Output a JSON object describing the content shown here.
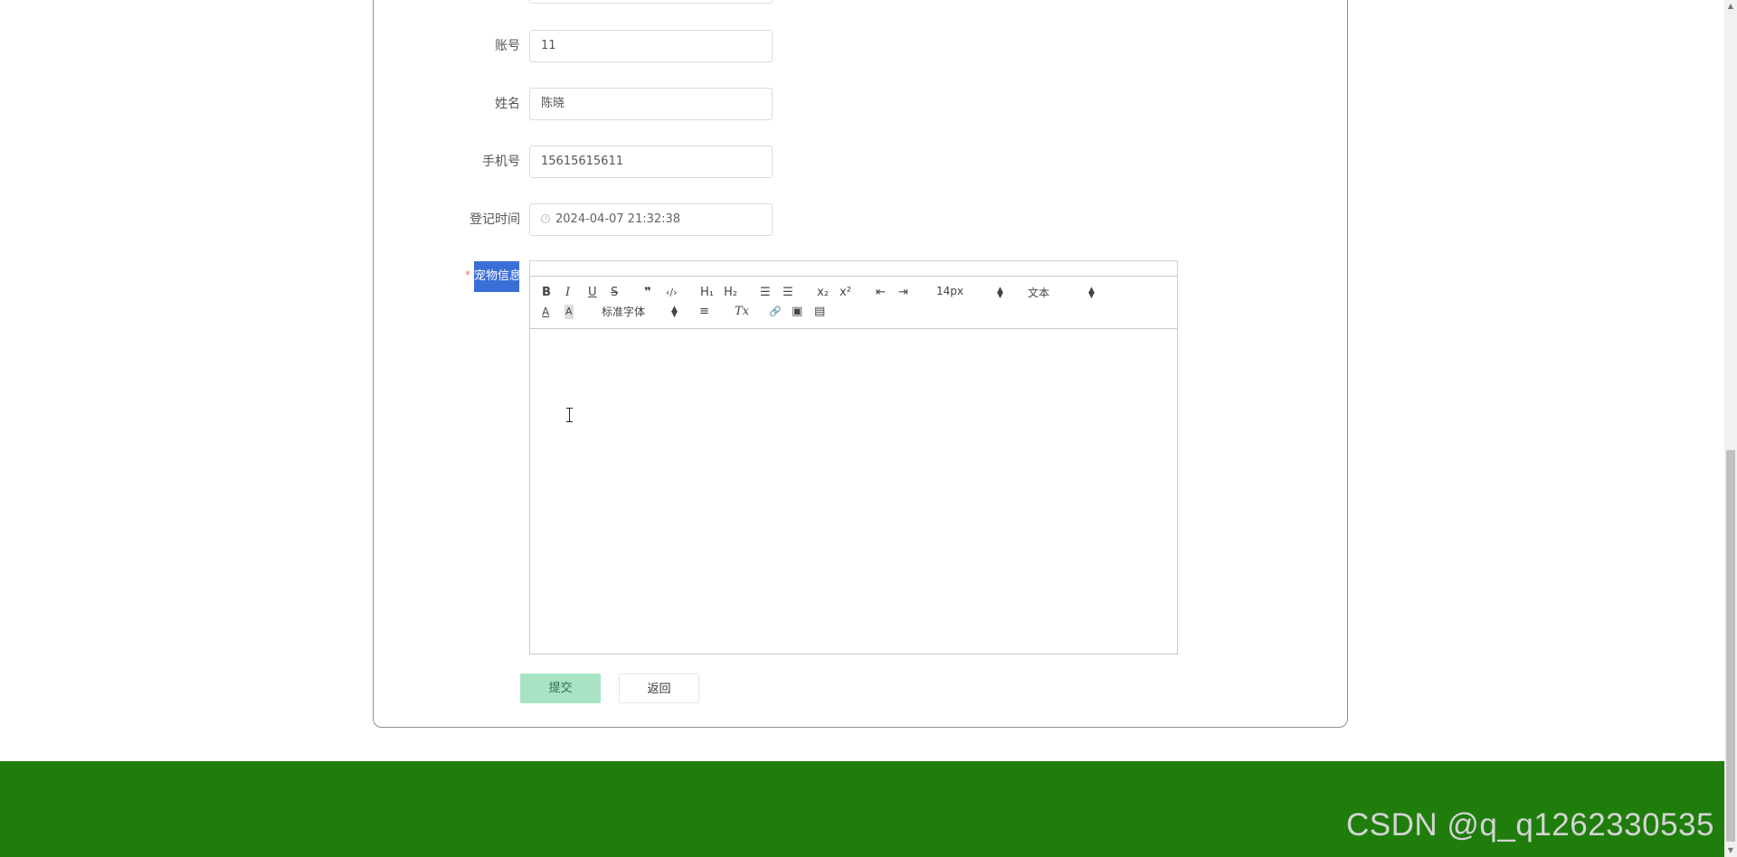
{
  "form": {
    "fields": [
      {
        "label": "账号",
        "value": "11"
      },
      {
        "label": "姓名",
        "value": "陈晓"
      },
      {
        "label": "手机号",
        "value": "15615615611"
      },
      {
        "label": "登记时间",
        "value": "2024-04-07 21:32:38"
      }
    ],
    "pet_info_label": "宠物信息",
    "required_marker": "*"
  },
  "editor": {
    "toolbar": {
      "bold": "B",
      "italic": "I",
      "underline": "U",
      "strike": "S",
      "blockquote": "❞",
      "code": "‹/›",
      "h1": "H₁",
      "h2": "H₂",
      "ordered_list": "☰",
      "bullet_list": "☰",
      "subscript": "x₂",
      "superscript": "x²",
      "outdent": "⇤",
      "indent": "⇥",
      "size_value": "14px",
      "header_value": "文本",
      "font_color": "A",
      "background_color": "A",
      "font_value": "标准字体",
      "align": "≡",
      "clean": "Tx",
      "link": "🔗",
      "image": "▣",
      "video": "▤"
    },
    "content": ""
  },
  "buttons": {
    "submit": "提交",
    "back": "返回"
  },
  "watermark": "CSDN @q_q1262330535",
  "colors": {
    "footer": "#1f7d0c",
    "submit_bg": "#a8e4c4",
    "label_highlight": "#3a6fd8"
  }
}
